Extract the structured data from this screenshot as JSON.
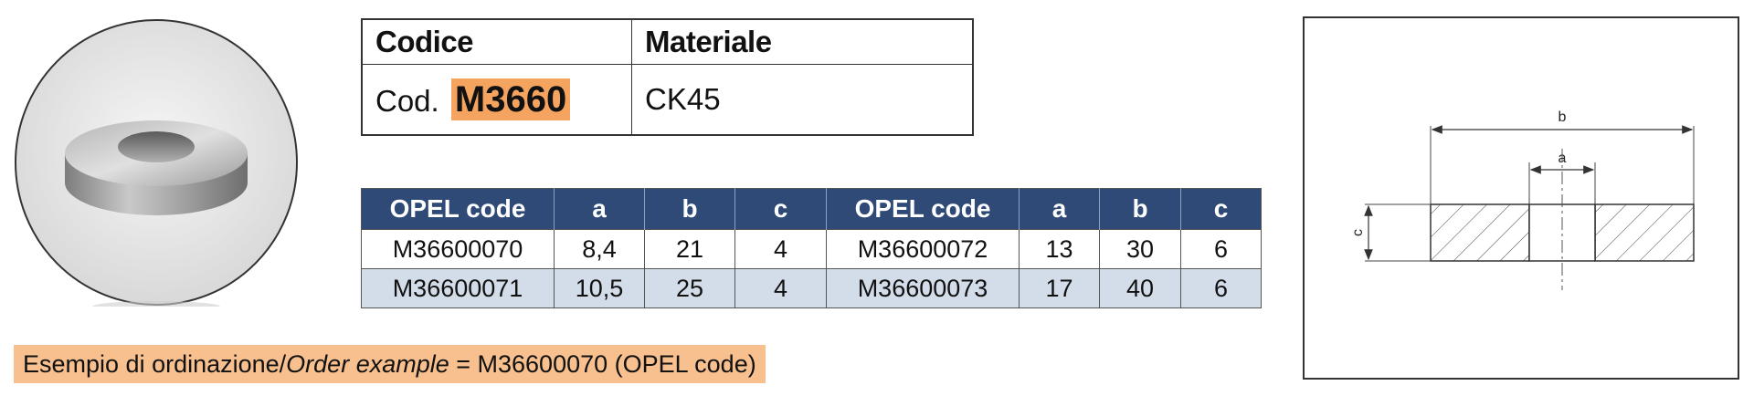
{
  "header_table": {
    "code_header": "Codice",
    "material_header": "Materiale",
    "code_prefix": "Cod.",
    "code_value": "M3660",
    "material_value": "CK45"
  },
  "data_table": {
    "headers": [
      "OPEL code",
      "a",
      "b",
      "c",
      "OPEL code",
      "a",
      "b",
      "c"
    ],
    "rows": [
      [
        "M36600070",
        "8,4",
        "21",
        "4",
        "M36600072",
        "13",
        "30",
        "6"
      ],
      [
        "M36600071",
        "10,5",
        "25",
        "4",
        "M36600073",
        "17",
        "40",
        "6"
      ]
    ]
  },
  "order_note": {
    "prefix": "Esempio di ordinazione/",
    "italic": "Order example",
    "suffix": " = M36600070 (OPEL code)"
  },
  "drawing": {
    "label_b": "b",
    "label_a": "a",
    "label_c": "c"
  },
  "colors": {
    "table_header_bg": "#2f4a77",
    "alt_row_bg": "#d3dce9",
    "highlight": "#f4a45f",
    "note_bg": "#f7c08e"
  }
}
